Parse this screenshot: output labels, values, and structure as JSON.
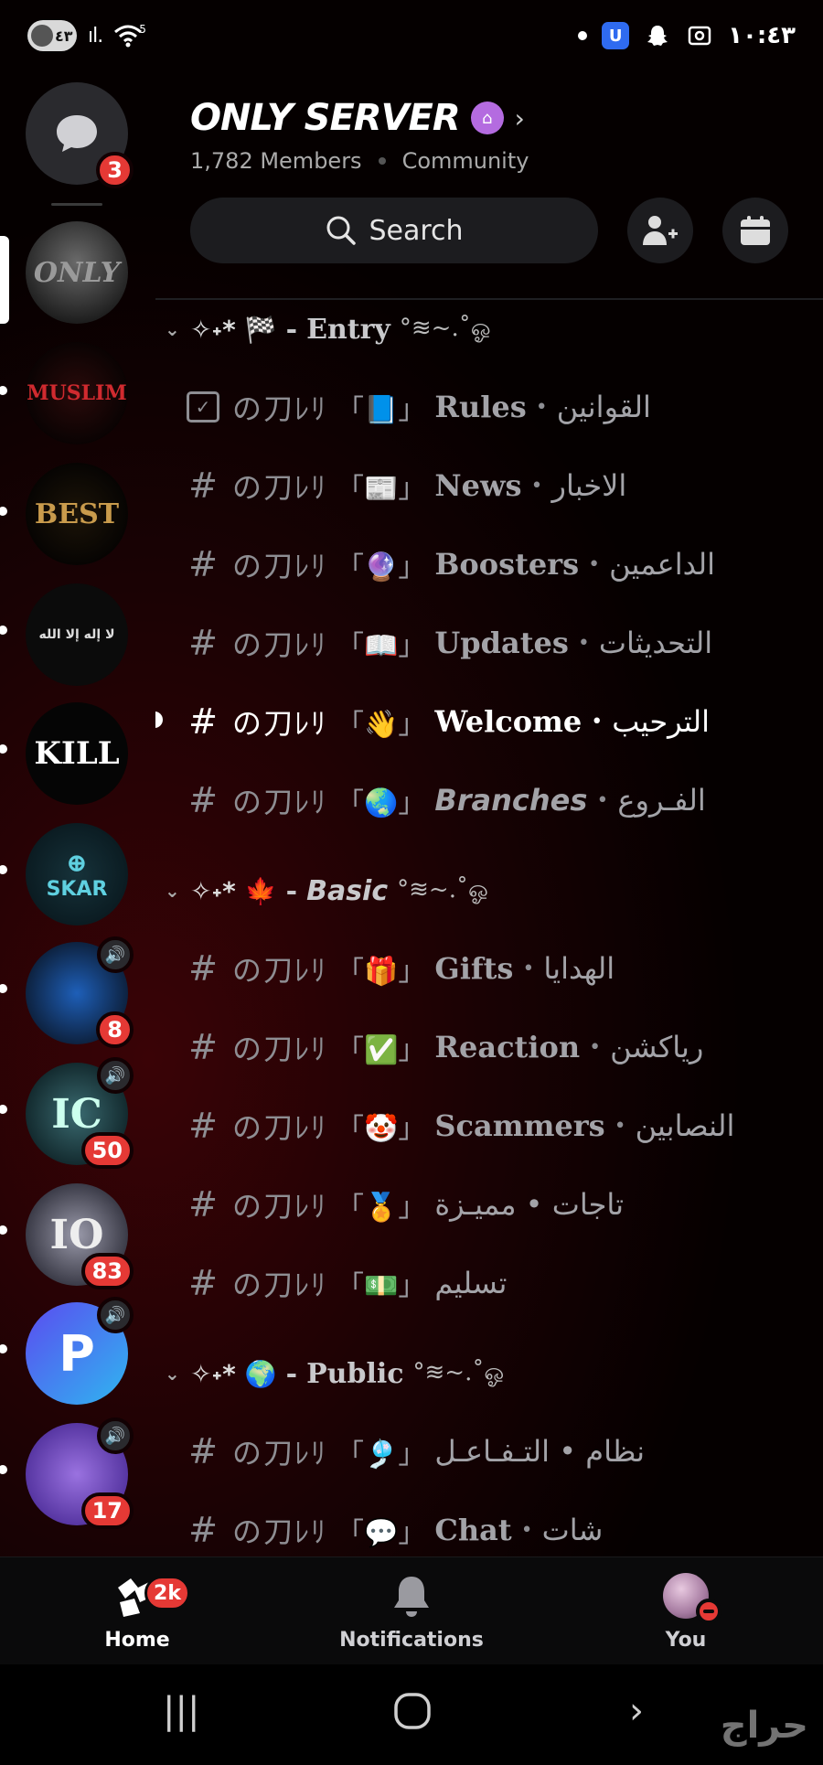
{
  "status_bar": {
    "left_pill_text": "٤٣",
    "signal_text": "ıl.",
    "wifi_label": "5",
    "time": "١٠:٤٣",
    "vpn_icon_label": "U"
  },
  "rail": {
    "dm_badge": "3",
    "servers": [
      {
        "label": "ONLY",
        "color": "#888888"
      },
      {
        "label": "MUSLIM",
        "color": "#c8262c"
      },
      {
        "label": "BEST",
        "color": "#c89a4a"
      },
      {
        "label": "لا إله إلا الله",
        "color": "#dddddd"
      },
      {
        "label": "KILL",
        "color": "#ffffff"
      },
      {
        "label": "SKAR",
        "color": "#5fd0e0"
      },
      {
        "label": "",
        "color": "#1e5fb8",
        "badge": "8"
      },
      {
        "label": "",
        "color": "#1a3b40",
        "badge": "50"
      },
      {
        "label": "",
        "color": "#8a8a9a",
        "badge": "83"
      },
      {
        "label": "",
        "color": "#3c7cf0"
      },
      {
        "label": "",
        "color": "#7a53c9",
        "badge": "17"
      }
    ]
  },
  "header": {
    "server_name": "ONLY SERVER",
    "members": "1,782 Members",
    "community": "Community",
    "search_label": "Search"
  },
  "categories": {
    "entry": {
      "emoji": "🏁",
      "label": "Entry",
      "tail": "°≋~.˚ஓ"
    },
    "basic": {
      "emoji": "🍁",
      "label": "Basic",
      "tail": "°≋~.˚ஓ"
    },
    "public": {
      "emoji": "🌍",
      "label": "Public",
      "tail": "°≋~.˚ஓ"
    }
  },
  "channels": {
    "prefix": "の刀ﾚﾘ",
    "rules": {
      "emoji": "📘",
      "name": "Rules",
      "ar": "القوانين"
    },
    "news": {
      "emoji": "📰",
      "name": "News",
      "ar": "الاخبار"
    },
    "boosters": {
      "emoji": "🔮",
      "name": "Boosters",
      "ar": "الداعمين"
    },
    "updates": {
      "emoji": "📖",
      "name": "Updates",
      "ar": "التحديثات"
    },
    "welcome": {
      "emoji": "👋",
      "name": "Welcome",
      "ar": "الترحيب"
    },
    "branches": {
      "emoji": "🌏",
      "name": "Branches",
      "ar": "الفـروع"
    },
    "gifts": {
      "emoji": "🎁",
      "name": "Gifts",
      "ar": "الهدايا"
    },
    "reaction": {
      "emoji": "✅",
      "name": "Reaction",
      "ar": "رياكشن"
    },
    "scammers": {
      "emoji": "🤡",
      "name": "Scammers",
      "ar": "النصابين"
    },
    "badges": {
      "emoji": "🏅",
      "name": "",
      "ar": "تاجات • مميـزة"
    },
    "delivery": {
      "emoji": "💵",
      "name": "",
      "ar": "تسليم"
    },
    "system": {
      "emoji": "🎐",
      "name": "",
      "ar": "نظام • التـفـاعـل"
    },
    "chat": {
      "emoji": "💬",
      "name": "Chat",
      "ar": "شات"
    }
  },
  "bottom_nav": {
    "home": "Home",
    "home_badge": "2k",
    "notifications": "Notifications",
    "you": "You"
  },
  "watermark": "حراج"
}
